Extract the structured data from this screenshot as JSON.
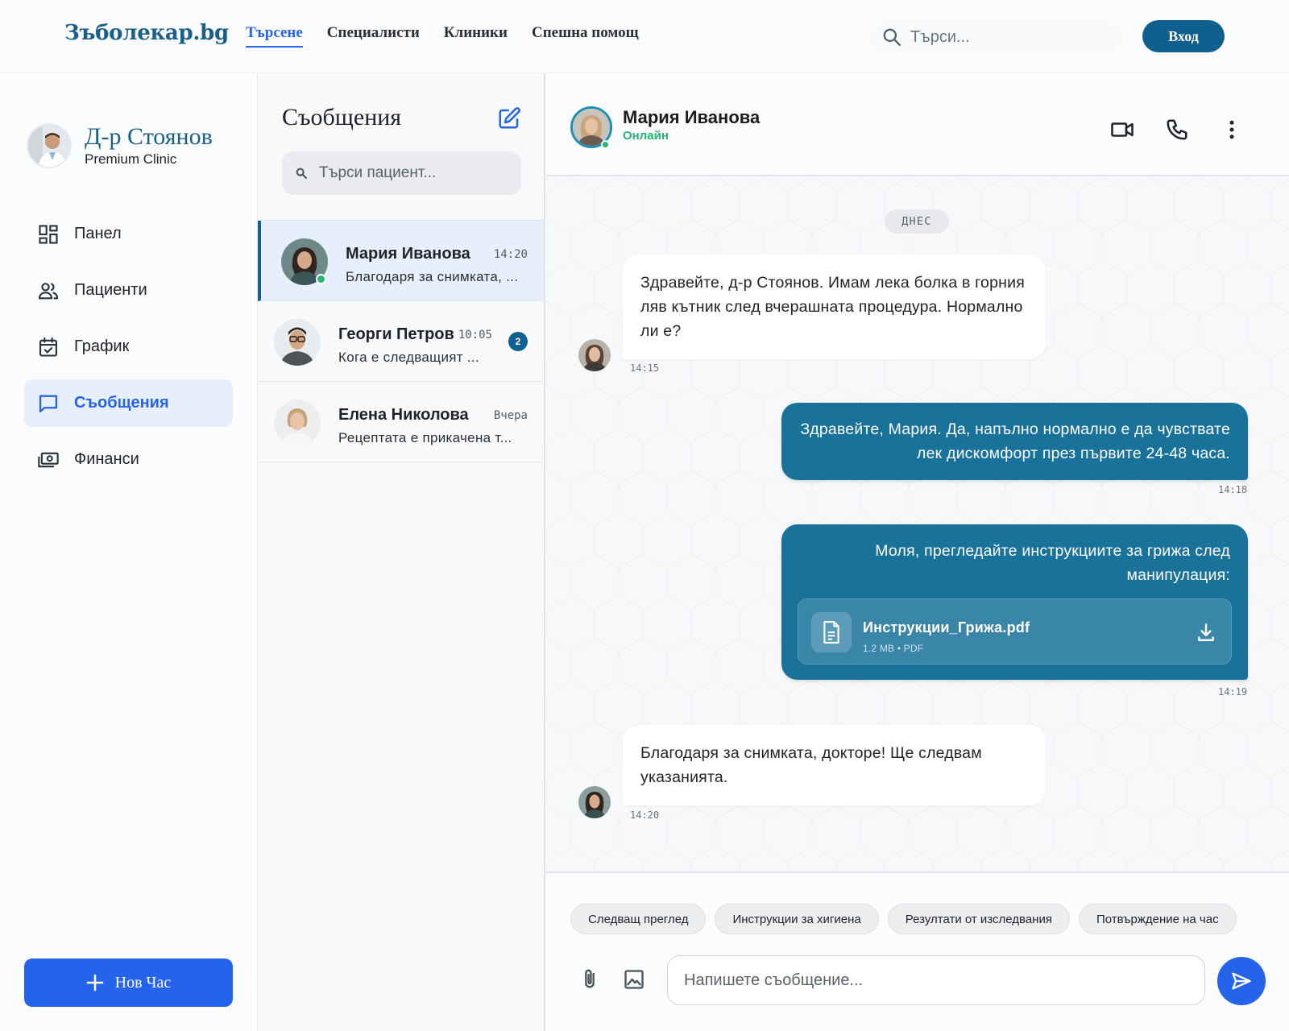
{
  "topnav": {
    "brand": "Зъболекар.bg",
    "links": [
      {
        "label": "Търсене",
        "active": true
      },
      {
        "label": "Специалисти",
        "active": false
      },
      {
        "label": "Клиники",
        "active": false
      },
      {
        "label": "Спешна помощ",
        "active": false
      }
    ],
    "search_placeholder": "Търси...",
    "login_label": "Вход"
  },
  "sidebar": {
    "doctor_name": "Д-р Стоянов",
    "clinic": "Premium Clinic",
    "items": [
      {
        "label": "Панел",
        "icon": "dashboard-icon",
        "active": false
      },
      {
        "label": "Пациенти",
        "icon": "users-icon",
        "active": false
      },
      {
        "label": "График",
        "icon": "calendar-icon",
        "active": false
      },
      {
        "label": "Съобщения",
        "icon": "chat-icon",
        "active": true
      },
      {
        "label": "Финанси",
        "icon": "money-icon",
        "active": false
      }
    ],
    "new_button": "Нов Час"
  },
  "conversations": {
    "title": "Съобщения",
    "search_placeholder": "Търси пациент...",
    "items": [
      {
        "name": "Мария Иванова",
        "time": "14:20",
        "preview": "Благодаря за снимката, ...",
        "active": true,
        "online": true,
        "unread": ""
      },
      {
        "name": "Георги Петров",
        "time": "10:05",
        "preview": "Кога е следващият ...",
        "active": false,
        "online": false,
        "unread": "2"
      },
      {
        "name": "Елена Николова",
        "time": "Вчера",
        "preview": "Рецептата е прикачена т...",
        "active": false,
        "online": false,
        "unread": ""
      }
    ]
  },
  "chat": {
    "contact_name": "Мария Иванова",
    "status": "Онлайн",
    "day_label": "ДНЕС",
    "messages": [
      {
        "direction": "in",
        "text": "Здравейте, д-р Стоянов. Имам лека болка в горния ляв кътник след вчерашната процедура. Нормално ли е?",
        "time": "14:15"
      },
      {
        "direction": "out",
        "text": "Здравейте, Мария. Да, напълно нормално е да чувствате лек дискомфорт през първите 24-48 часа.",
        "time": "14:18"
      },
      {
        "direction": "out",
        "text": "Моля, прегледайте инструкциите за грижа след манипулация:",
        "time": "14:19",
        "attachment": {
          "name": "Инструкции_Грижа.pdf",
          "meta": "1.2 MB • PDF"
        }
      },
      {
        "direction": "in",
        "text": "Благодаря за снимката, докторе! Ще следвам указанията.",
        "time": "14:20"
      }
    ],
    "quick_replies": [
      "Следващ преглед",
      "Инструкции за хигиена",
      "Резултати от изследвания",
      "Потвърждение на час"
    ],
    "input_placeholder": "Напишете съобщение...",
    "accent_color": "#19729a",
    "primary_color": "#2563eb"
  }
}
